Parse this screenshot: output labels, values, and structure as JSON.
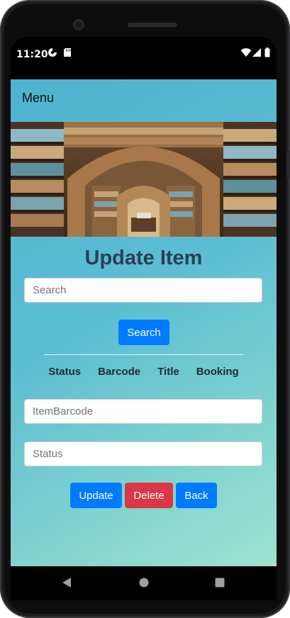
{
  "status_bar": {
    "time": "11:20"
  },
  "app": {
    "menu_label": "Menu",
    "page_title": "Update Item",
    "search": {
      "placeholder": "Search",
      "button_label": "Search"
    },
    "table_headers": [
      "Status",
      "Barcode",
      "Title",
      "Booking"
    ],
    "item_barcode_placeholder": "ItemBarcode",
    "status_placeholder": "Status",
    "buttons": {
      "update": "Update",
      "delete": "Delete",
      "back": "Back"
    }
  },
  "colors": {
    "primary": "#007bff",
    "danger": "#dc3545",
    "title": "#2b3f55",
    "background_start": "#4eb3d0",
    "background_end": "#9ee3cf"
  },
  "icons": {
    "status_bar": [
      "vpn-icon",
      "sd-card-icon",
      "wifi-icon",
      "signal-icon",
      "battery-icon"
    ],
    "navigation": [
      "back-icon",
      "home-icon",
      "recents-icon"
    ]
  }
}
